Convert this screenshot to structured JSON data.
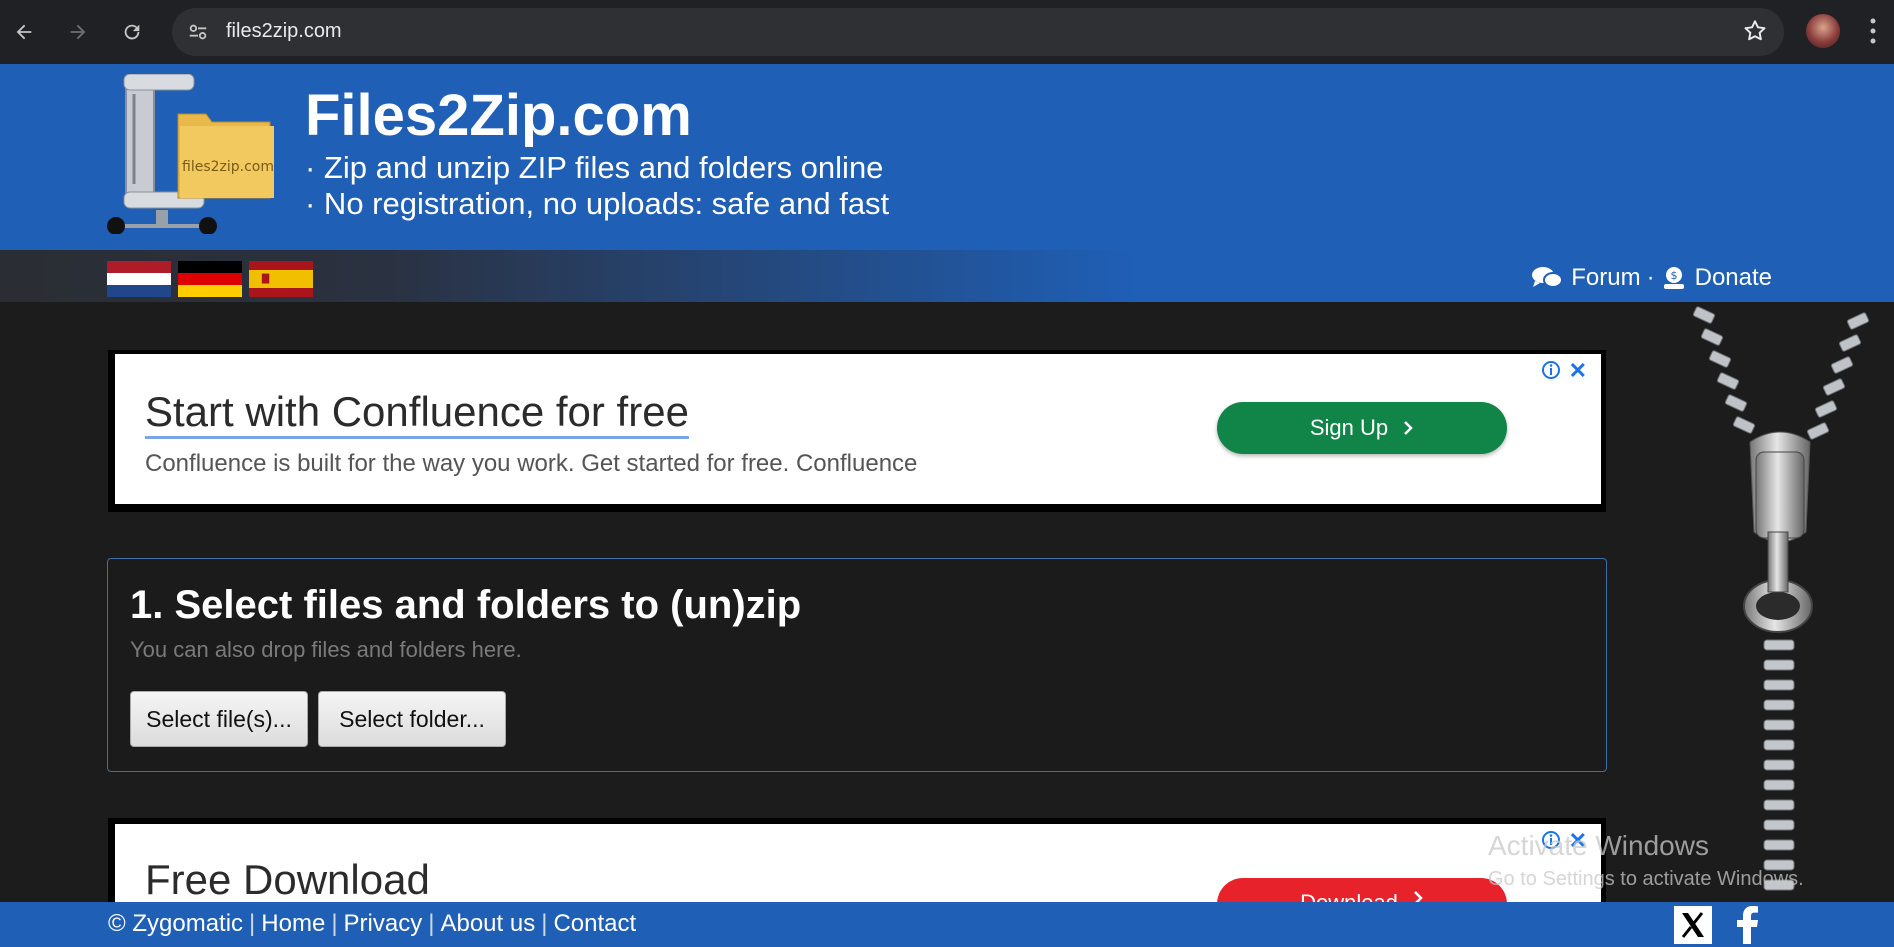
{
  "browser": {
    "url": "files2zip.com",
    "icons": [
      "back-icon",
      "forward-icon",
      "reload-icon",
      "site-info-icon",
      "star-icon",
      "avatar",
      "menu-icon"
    ]
  },
  "header": {
    "logo_text": "files2zip.com",
    "title": "Files2Zip.com",
    "tagline1": "· Zip and unzip ZIP files and folders online",
    "tagline2": "· No registration, no uploads: safe and fast",
    "languages": [
      "Dutch",
      "German",
      "Spanish"
    ],
    "forum": "Forum",
    "dot": "·",
    "donate": "Donate",
    "colors": {
      "brand": "#1f5fb6"
    }
  },
  "ad1": {
    "title": "Start with Confluence for free",
    "description": "Confluence is built for the way you work. Get started for free. Confluence",
    "button": "Sign Up",
    "close": "✕",
    "button_color": "#118447"
  },
  "panel": {
    "title": "1. Select files and folders to (un)zip",
    "subtitle": "You can also drop files and folders here.",
    "select_files": "Select file(s)...",
    "select_folder": "Select folder..."
  },
  "ad2": {
    "title": "Free Download",
    "button": "Download",
    "close": "✕",
    "button_color": "#e8222a"
  },
  "watermark": {
    "line1": "Activate Windows",
    "line2": "Go to Settings to activate Windows."
  },
  "footer": {
    "copyright": "© Zygomatic",
    "home": "Home",
    "privacy": "Privacy",
    "about": "About us",
    "contact": "Contact",
    "separator": "|"
  }
}
